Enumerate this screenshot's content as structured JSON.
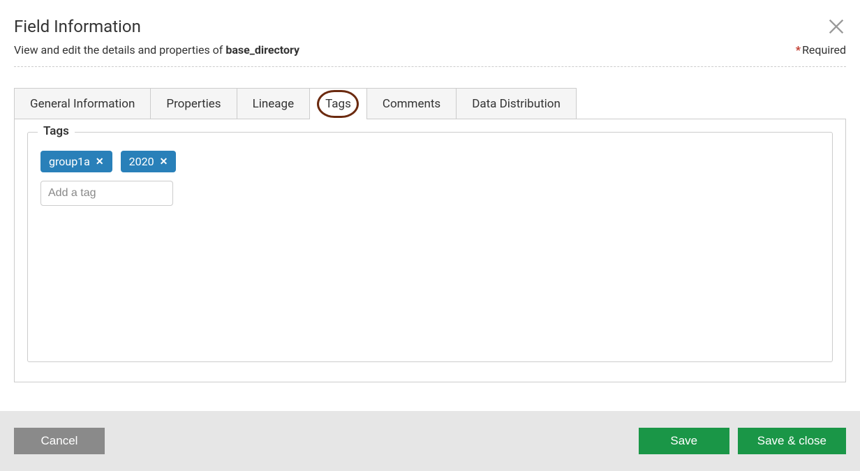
{
  "header": {
    "title": "Field Information",
    "subtitle_prefix": "View and edit the details and properties of ",
    "entity_name": "base_directory",
    "required_label": "Required",
    "required_asterisk": "*"
  },
  "tabs": {
    "general": "General Information",
    "properties": "Properties",
    "lineage": "Lineage",
    "tags": "Tags",
    "comments": "Comments",
    "data_distribution": "Data Distribution",
    "active_index": 3
  },
  "tags_panel": {
    "legend": "Tags",
    "items": [
      {
        "label": "group1a"
      },
      {
        "label": "2020"
      }
    ],
    "input_placeholder": "Add a tag"
  },
  "footer": {
    "cancel": "Cancel",
    "save": "Save",
    "save_close": "Save & close"
  }
}
